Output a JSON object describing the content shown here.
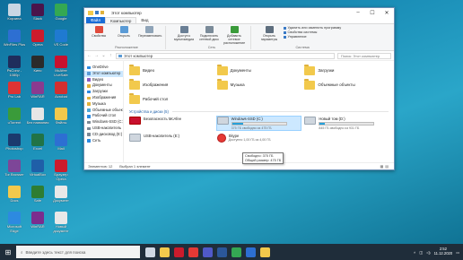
{
  "desktop_icons": [
    {
      "label": "Корзина",
      "color": "#c9d6e3"
    },
    {
      "label": "WinFiles Plus",
      "color": "#2d6fd2"
    },
    {
      "label": "PsConv - 1080p",
      "color": "#1f2d5c"
    },
    {
      "label": "Pro Lab",
      "color": "#d33"
    },
    {
      "label": "uTorrent",
      "color": "#3a9b3a"
    },
    {
      "label": "Photoshop",
      "color": "#1b3a6e"
    },
    {
      "label": "Tor Browser",
      "color": "#7d4698"
    },
    {
      "label": "Docs",
      "color": "#f2c94c"
    },
    {
      "label": "Microsoft Edge",
      "color": "#2d8ae0"
    },
    {
      "label": "Slack",
      "color": "#4a154b"
    },
    {
      "label": "Opera",
      "color": "#cc1b2c"
    },
    {
      "label": "Кино",
      "color": "#2b2b2b"
    },
    {
      "label": "WinRAR",
      "color": "#8a3b8f"
    },
    {
      "label": "Без названия",
      "color": "#e6e6e6"
    },
    {
      "label": "Excel",
      "color": "#217346"
    },
    {
      "label": "VirtualBox",
      "color": "#1f5fa8"
    },
    {
      "label": "Safe",
      "color": "#2e7d32"
    },
    {
      "label": "WinRAR",
      "color": "#7b2d8e"
    },
    {
      "label": "Google",
      "color": "#34a853"
    },
    {
      "label": "VS Code",
      "color": "#1f7ad1"
    },
    {
      "label": "McAfee LiveSafe",
      "color": "#c8102e"
    },
    {
      "label": "Acrobat",
      "color": "#d32f2f"
    },
    {
      "label": "Файлы",
      "color": "#f2c94c"
    },
    {
      "label": "Mail",
      "color": "#2d6fd2"
    },
    {
      "label": "Браузер Opera",
      "color": "#cc1b2c"
    },
    {
      "label": "Документ",
      "color": "#e8e8e8"
    },
    {
      "label": "Новый документ",
      "color": "#e8e8e8"
    },
    {
      "label": "Инструкция",
      "color": "#5bb85d"
    },
    {
      "label": "Информация",
      "color": "#2d6fd2"
    },
    {
      "label": "Кино",
      "color": "#444"
    },
    {
      "label": "Скриншот",
      "color": "#e8e8e8"
    },
    {
      "label": "ВИРУС",
      "color": "#c62828"
    }
  ],
  "window": {
    "title": "Этот компьютер",
    "tabs": {
      "file": "Файл",
      "computer": "Компьютер",
      "view": "Вид"
    },
    "ribbon": {
      "group_location": {
        "name": "Расположение",
        "buttons": [
          "Свойства",
          "Открыть",
          "Переименовать"
        ]
      },
      "group_media": {
        "name": "Сеть",
        "buttons": [
          "Доступ к мультимедиа",
          "Подключить сетевой диск",
          "Добавить сетевое расположение"
        ]
      },
      "group_system": {
        "name": "Система",
        "open_settings": "Открыть параметры",
        "links": [
          "Удалить или изменить программу",
          "Свойства системы",
          "Управление"
        ]
      }
    },
    "address": {
      "path": "Этот компьютер",
      "search_placeholder": "Поиск: Этот компьютер"
    },
    "nav_pane": [
      {
        "label": "OneDrive",
        "color": "#2d8ae0"
      },
      {
        "label": "Этот компьютер",
        "color": "#5a9bd6",
        "selected": true
      },
      {
        "label": "Видео",
        "color": "#8a5cc2"
      },
      {
        "label": "Документы",
        "color": "#e0b23c"
      },
      {
        "label": "Загрузки",
        "color": "#2d8ae0"
      },
      {
        "label": "Изображения",
        "color": "#e0b23c"
      },
      {
        "label": "Музыка",
        "color": "#e0b23c"
      },
      {
        "label": "Объемные объекты",
        "color": "#4fa8d8"
      },
      {
        "label": "Рабочий стол",
        "color": "#2d8ae0"
      },
      {
        "label": "Windows-SSD (C:)",
        "color": "#7a8896"
      },
      {
        "label": "USB-накопитель",
        "color": "#7a8896"
      },
      {
        "label": "CD-дисковод (E:)",
        "color": "#7a8896"
      },
      {
        "label": "Сеть",
        "color": "#2d8ae0"
      }
    ],
    "folders": [
      {
        "label": "Видео"
      },
      {
        "label": "Документы"
      },
      {
        "label": "Загрузки"
      },
      {
        "label": "Изображения"
      },
      {
        "label": "Музыка"
      },
      {
        "label": "Объемные объекты"
      },
      {
        "label": "Рабочий стол"
      }
    ],
    "devices_header": "Устройства и диски (5)",
    "drives": [
      {
        "label": "Безопасность McAfee",
        "free": "",
        "usage": null,
        "type": "mcafee"
      },
      {
        "label": "Windows-SSD (C:)",
        "free": "375 ГБ свободно из 475 ГБ",
        "usage": 0.21,
        "type": "disk",
        "highlighted": true
      },
      {
        "label": "Новый том (D:)",
        "free": "845 ГБ свободно из 931 ГБ",
        "usage": 0.09,
        "type": "disk"
      },
      {
        "label": "USB-накопитель (E:)",
        "free": "",
        "usage": null,
        "type": "usb"
      },
      {
        "label": "Skype",
        "free": "Доступно 1,00 ГБ из 4,00 ГБ",
        "usage": null,
        "type": "skype"
      }
    ],
    "tooltip": {
      "line1": "Свободно: 375 ГБ",
      "line2": "Общий размер: 475 ГБ"
    },
    "status": {
      "items": "Элементов: 12",
      "selected": "Выбран 1 элемент"
    }
  },
  "taskbar": {
    "search_placeholder": "Введите здесь текст для поиска",
    "apps": [
      {
        "name": "task-view",
        "color": "#cfd8e3"
      },
      {
        "name": "explorer",
        "color": "#f2c94c"
      },
      {
        "name": "opera",
        "color": "#cc1b2c"
      },
      {
        "name": "yandex",
        "color": "#e53935"
      },
      {
        "name": "teams",
        "color": "#5059c9"
      },
      {
        "name": "word",
        "color": "#2b579a"
      },
      {
        "name": "chrome",
        "color": "#34a853"
      },
      {
        "name": "mail",
        "color": "#2d6fd2"
      },
      {
        "name": "files",
        "color": "#f2c94c"
      }
    ],
    "time": "2:52",
    "date": "11.12.2020"
  }
}
